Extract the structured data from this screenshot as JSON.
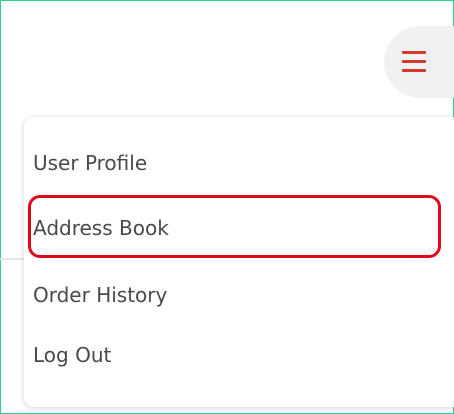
{
  "header": {
    "menu_icon": "hamburger-menu-icon"
  },
  "dropdown": {
    "items": [
      {
        "label": "User Profile"
      },
      {
        "label": "Address Book"
      },
      {
        "label": "Order History"
      },
      {
        "label": "Log Out"
      }
    ]
  },
  "annotation": {
    "highlighted_item": "Address Book",
    "highlight_color": "#e0091b"
  },
  "colors": {
    "accent": "#d23a2b",
    "frame_border": "#2fd08f",
    "text": "#4a4a4a"
  }
}
